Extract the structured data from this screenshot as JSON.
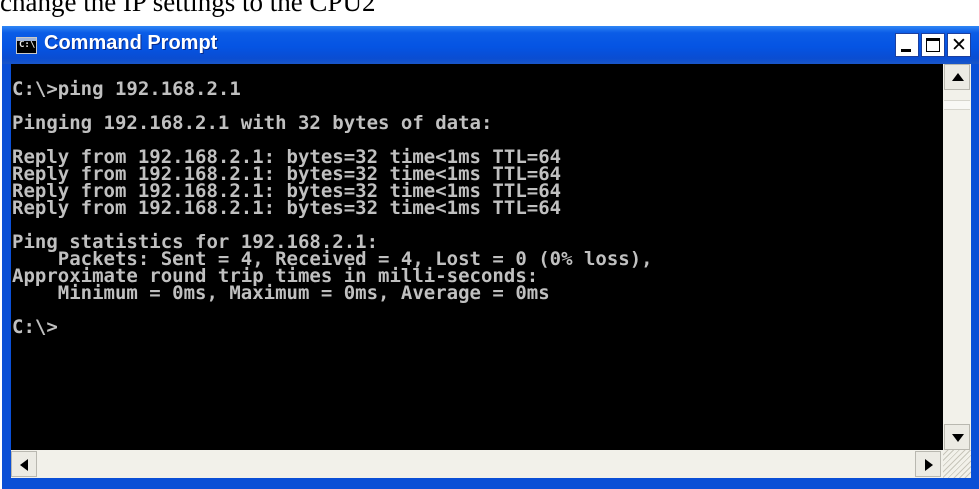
{
  "document": {
    "text_above": "change the IP settings to the CPU2"
  },
  "window": {
    "title": "Command Prompt",
    "icon_text": "C:\\",
    "controls": {
      "minimize": "minimize",
      "maximize": "maximize",
      "close": "✕"
    }
  },
  "console": {
    "lines": [
      "C:\\>ping 192.168.2.1",
      "",
      "Pinging 192.168.2.1 with 32 bytes of data:",
      "",
      "Reply from 192.168.2.1: bytes=32 time<1ms TTL=64",
      "Reply from 192.168.2.1: bytes=32 time<1ms TTL=64",
      "Reply from 192.168.2.1: bytes=32 time<1ms TTL=64",
      "Reply from 192.168.2.1: bytes=32 time<1ms TTL=64",
      "",
      "Ping statistics for 192.168.2.1:",
      "    Packets: Sent = 4, Received = 4, Lost = 0 (0% loss),",
      "Approximate round trip times in milli-seconds:",
      "    Minimum = 0ms, Maximum = 0ms, Average = 0ms",
      "",
      "C:\\>"
    ]
  },
  "colors": {
    "console_bg": "#000000",
    "console_fg": "#c0c0c0",
    "titlebar": "#0554e3",
    "frame": "#0a4fd6"
  },
  "icons": {
    "app": "cmd-icon",
    "scroll_up": "arrow-up-icon",
    "scroll_down": "arrow-down-icon",
    "scroll_left": "arrow-left-icon",
    "scroll_right": "arrow-right-icon",
    "resize": "resize-grip-icon"
  }
}
